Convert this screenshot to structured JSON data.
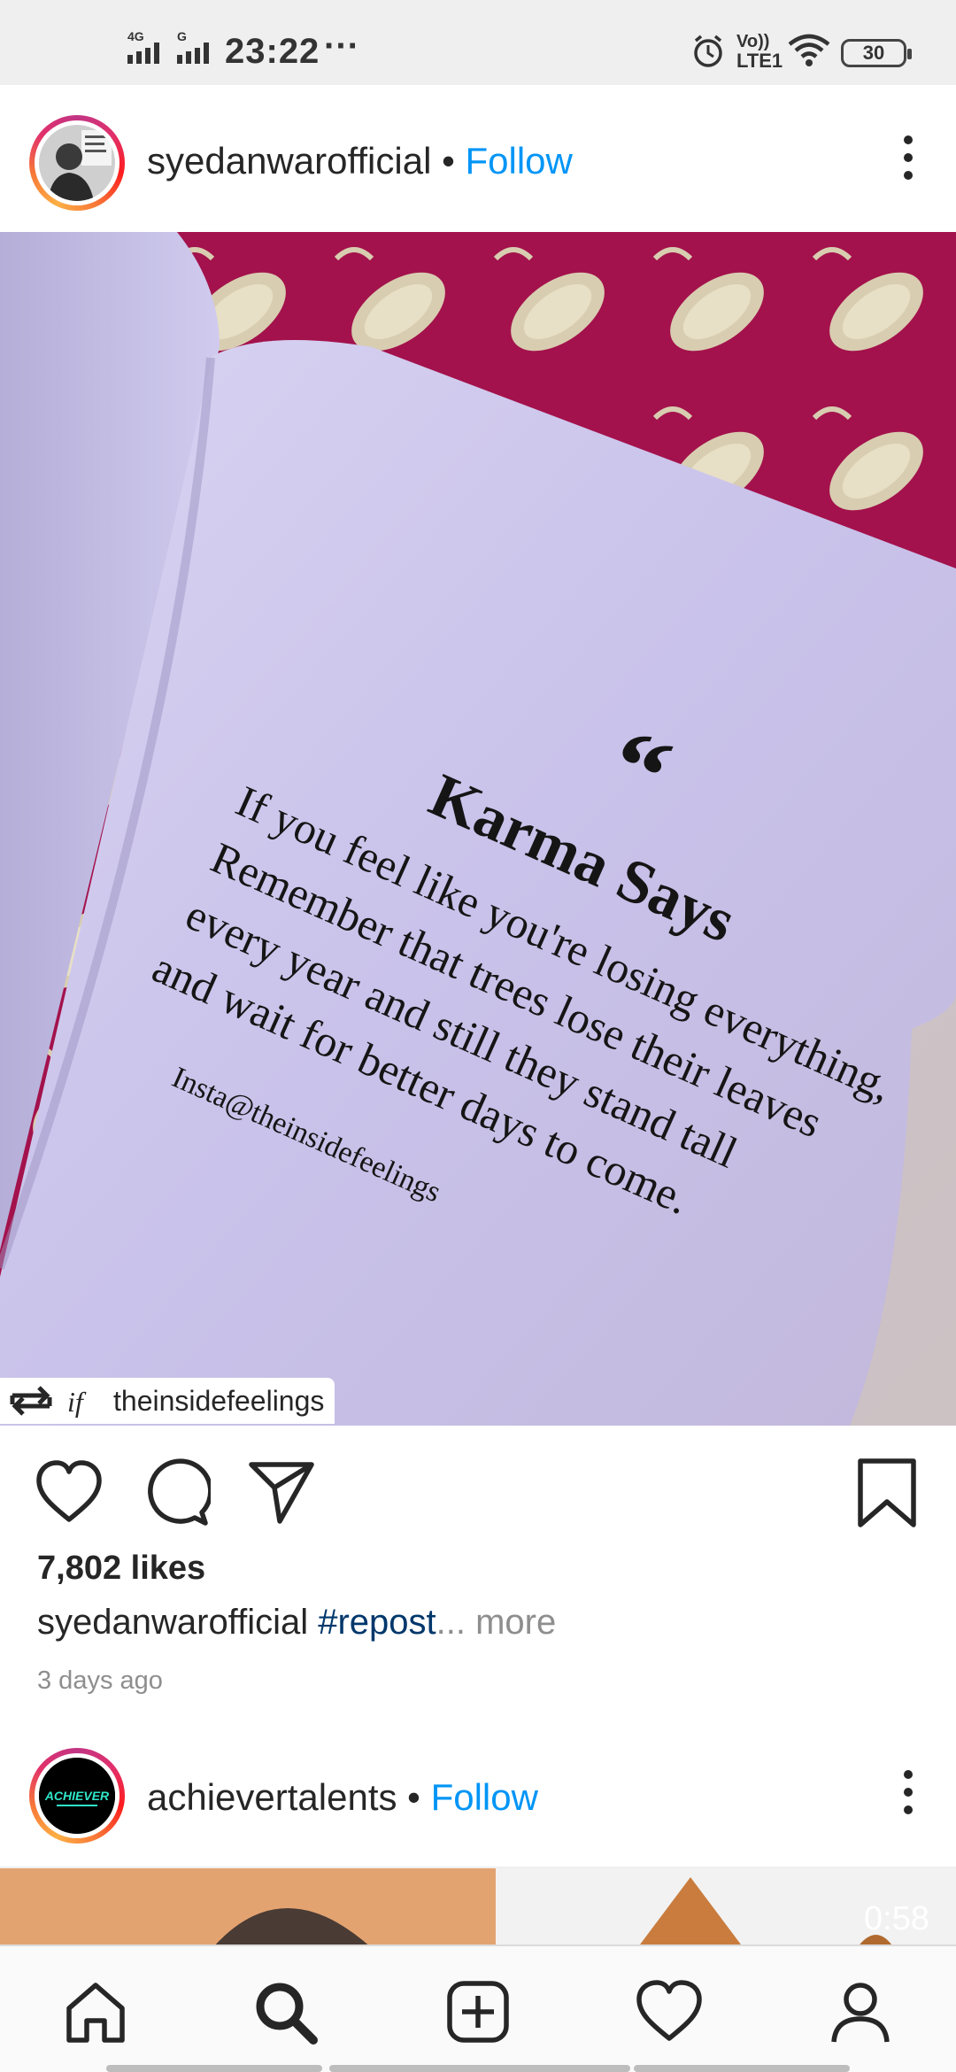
{
  "status_bar": {
    "signal1_label": "4G",
    "signal2_label": "G",
    "time": "23:22",
    "dots": "···",
    "volte_top": "Vo))",
    "volte_bottom": "LTE1",
    "battery": "30"
  },
  "post1": {
    "username": "syedanwarofficial",
    "separator": "•",
    "follow_label": "Follow",
    "image_text": {
      "quote_mark": "“",
      "title": "Karma Says",
      "lines": [
        "If you feel like you're losing everything,",
        "Remember that trees lose their leaves",
        "every year and still they stand tall",
        "and wait for better days to come."
      ],
      "credit": "Insta@theinsidefeelings"
    },
    "repost_from": "theinsidefeelings",
    "likes": "7,802 likes",
    "caption_user": "syedanwarofficial",
    "caption_hashtag": "#repost",
    "caption_ellipsis": "...",
    "caption_more": " more",
    "time_ago": "3 days ago"
  },
  "post2": {
    "username": "achievertalents",
    "separator": "•",
    "follow_label": "Follow",
    "avatar_text": "ACHIEVER",
    "video_time": "0:58"
  },
  "icons": {
    "like": "heart-icon",
    "comment": "comment-icon",
    "share": "paper-plane-icon",
    "save": "bookmark-icon",
    "home": "home-icon",
    "search": "search-icon",
    "create": "plus-square-icon",
    "activity": "heart-icon",
    "profile": "profile-icon"
  },
  "colors": {
    "follow_blue": "#0095f6",
    "hashtag_blue": "#00376b",
    "muted": "#8e8e8e"
  }
}
